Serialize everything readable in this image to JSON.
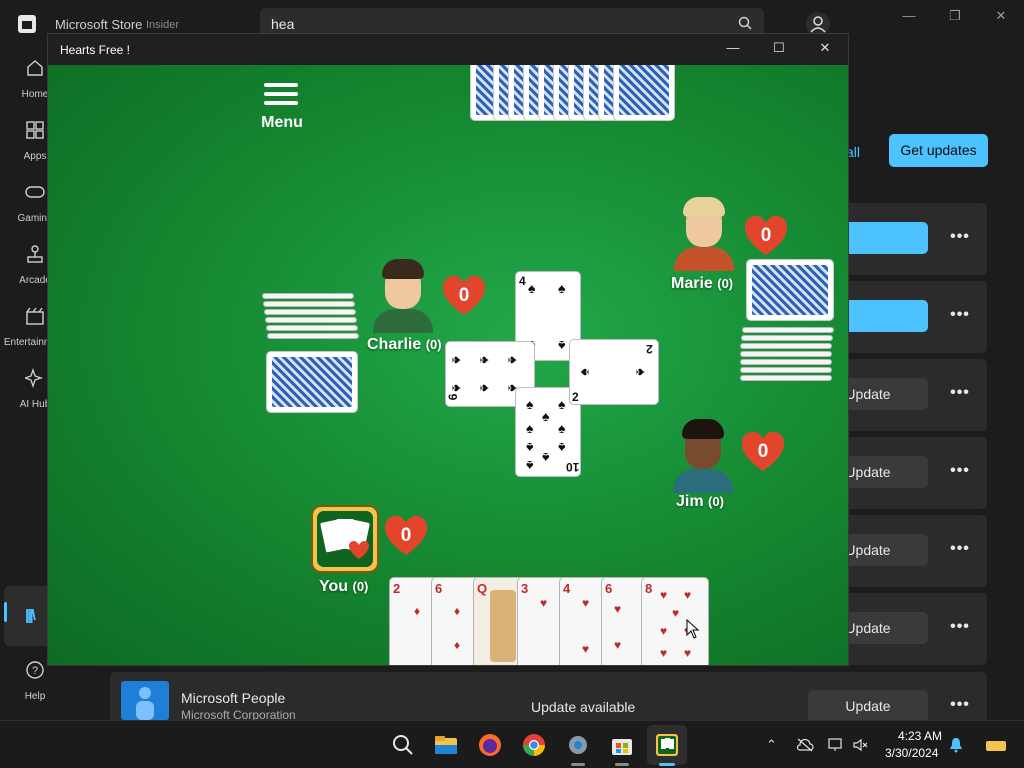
{
  "store": {
    "title": "Microsoft Store",
    "badge": "Insider",
    "search_value": "hea",
    "nav": [
      {
        "label": "Home",
        "icon": "home-icon"
      },
      {
        "label": "Apps",
        "icon": "apps-icon"
      },
      {
        "label": "Gaming",
        "icon": "gaming-icon"
      },
      {
        "label": "Arcade",
        "icon": "arcade-icon"
      },
      {
        "label": "Entertainment",
        "icon": "entertainment-icon"
      },
      {
        "label": "AI Hub",
        "icon": "ai-hub-icon"
      }
    ],
    "library_icon": "library-icon",
    "help_label": "Help",
    "update_all_fragment": "all",
    "get_updates_label": "Get updates",
    "row_buttons": [
      "",
      "",
      "Update",
      "Update",
      "Update",
      "Update"
    ],
    "people": {
      "name": "Microsoft People",
      "publisher": "Microsoft Corporation",
      "status": "Update available",
      "button": "Update"
    },
    "accent": "#4cc2ff"
  },
  "hearts": {
    "title": "Hearts Free !",
    "menu_label": "Menu",
    "players": {
      "charlie": {
        "name": "Charlie",
        "score": "(0)",
        "hearts": "0"
      },
      "marie": {
        "name": "Marie",
        "score": "(0)",
        "hearts": "0"
      },
      "jim": {
        "name": "Jim",
        "score": "(0)",
        "hearts": "0"
      },
      "you": {
        "name": "You",
        "score": "(0)",
        "hearts": "0"
      }
    },
    "trick": {
      "top": "4",
      "left": "9",
      "right": "2",
      "bottom": "10",
      "bottom_alt": "2"
    },
    "hand": [
      "2",
      "6",
      "Q",
      "3",
      "4",
      "6",
      "8"
    ],
    "table_color": "#14852f",
    "heart_color": "#e2452b"
  },
  "taskbar": {
    "time": "4:23 AM",
    "date": "3/30/2024"
  }
}
